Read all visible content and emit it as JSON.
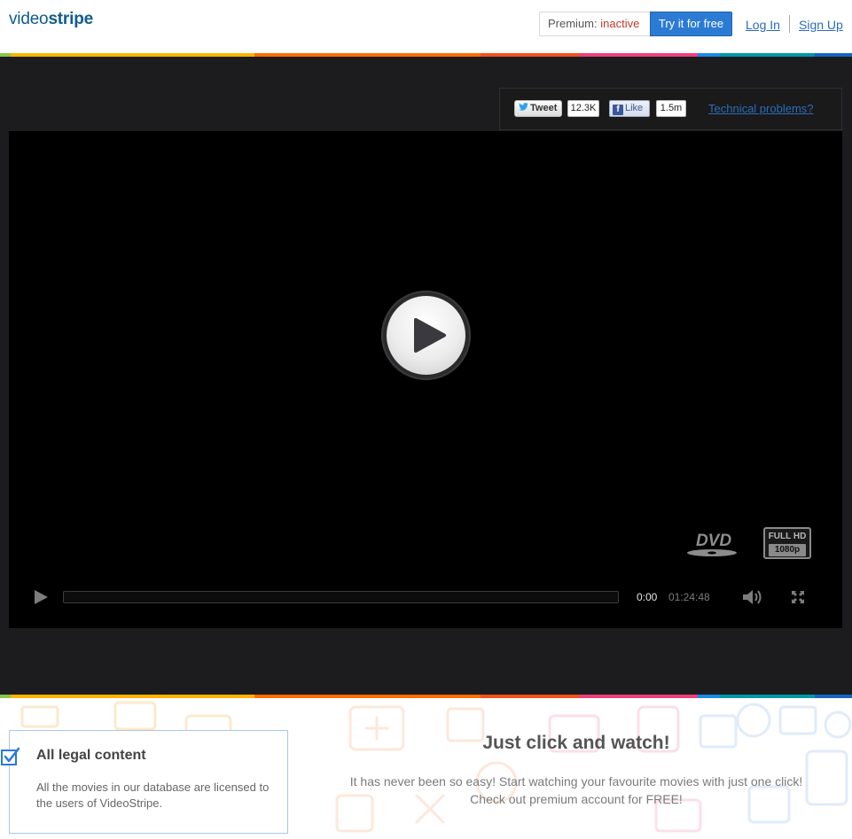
{
  "header": {
    "logo_light": "video",
    "logo_bold": "stripe",
    "premium_label": "Premium:",
    "premium_status": "inactive",
    "try_button": "Try it for free",
    "login": "Log In",
    "signup": "Sign Up"
  },
  "stripe_colors": [
    "#8bc34a",
    "#ffb300",
    "#ff6d00",
    "#f4511e",
    "#ec407a",
    "#1e88e5",
    "#0097a7",
    "#1565c0"
  ],
  "social": {
    "tweet_label": "Tweet",
    "tweet_count": "12.3K",
    "like_label": "Like",
    "like_count": "1.5m",
    "tech_problems": "Technical problems?"
  },
  "player": {
    "badges": [
      "DVD",
      "FULL HD",
      "1080p"
    ],
    "current_time": "0:00",
    "total_time": "01:24:48",
    "progress_fraction": 0.0,
    "icons": [
      "play-icon",
      "volume-icon",
      "fullscreen-icon",
      "big-play-icon"
    ]
  },
  "bottom": {
    "legal_title": "All legal content",
    "legal_text": "All the movies in our database are licensed to the users of VideoStripe.",
    "watch_title": "Just click and watch!",
    "watch_line1": "It has never been so easy! Start watching your favourite movies with just one click!",
    "watch_line2": "Check out premium account for FREE!"
  },
  "colors": {
    "accent": "#2b7bd4",
    "link": "#2b6cb8",
    "logo": "#0d5c91",
    "stage": "#1c1c1e",
    "inactive": "#c0392b"
  }
}
